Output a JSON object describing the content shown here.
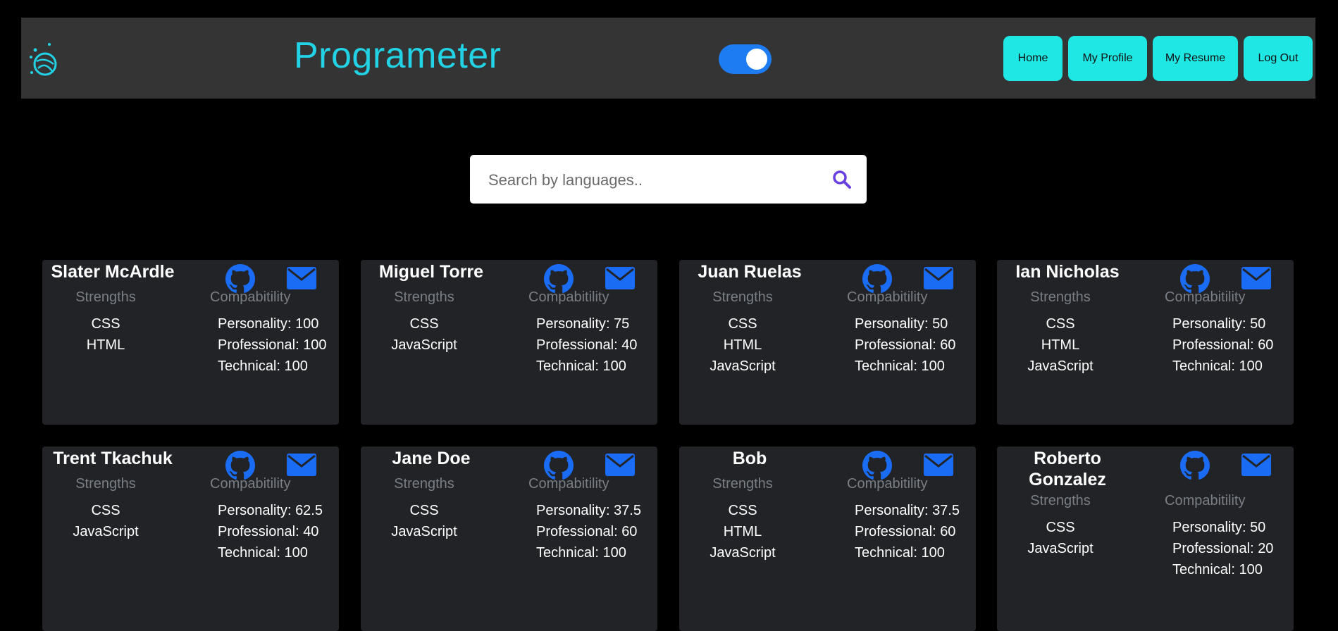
{
  "header": {
    "title": "Programeter",
    "nav": [
      "Home",
      "My Profile",
      "My Resume",
      "Log Out"
    ],
    "toggle": "on"
  },
  "search": {
    "placeholder": "Search by languages..",
    "value": ""
  },
  "labels": {
    "strengths": "Strengths",
    "compatibility": "Compabitility",
    "personality": "Personality",
    "professional": "Professional",
    "technical": "Technical"
  },
  "cards": [
    {
      "name": "Slater McArdle",
      "strengths": [
        "CSS",
        "HTML"
      ],
      "personality": "100",
      "professional": "100",
      "technical": "100"
    },
    {
      "name": "Miguel Torre",
      "strengths": [
        "CSS",
        "JavaScript"
      ],
      "personality": "75",
      "professional": "40",
      "technical": "100"
    },
    {
      "name": "Juan Ruelas",
      "strengths": [
        "CSS",
        "HTML",
        "JavaScript"
      ],
      "personality": "50",
      "professional": "60",
      "technical": "100"
    },
    {
      "name": "Ian Nicholas",
      "strengths": [
        "CSS",
        "HTML",
        "JavaScript"
      ],
      "personality": "50",
      "professional": "60",
      "technical": "100"
    },
    {
      "name": "Trent Tkachuk",
      "strengths": [
        "CSS",
        "JavaScript"
      ],
      "personality": "62.5",
      "professional": "40",
      "technical": "100"
    },
    {
      "name": "Jane Doe",
      "strengths": [
        "CSS",
        "JavaScript"
      ],
      "personality": "37.5",
      "professional": "60",
      "technical": "100"
    },
    {
      "name": "Bob",
      "strengths": [
        "CSS",
        "HTML",
        "JavaScript"
      ],
      "personality": "37.5",
      "professional": "60",
      "technical": "100"
    },
    {
      "name": "Roberto Gonzalez",
      "strengths": [
        "CSS",
        "JavaScript"
      ],
      "personality": "50",
      "professional": "20",
      "technical": "100"
    }
  ],
  "colors": {
    "accent": "#22d3e6",
    "button": "#1fe7e3",
    "icon_blue": "#1a6cf5",
    "card_bg": "#212327",
    "navbar_bg": "#343434"
  }
}
